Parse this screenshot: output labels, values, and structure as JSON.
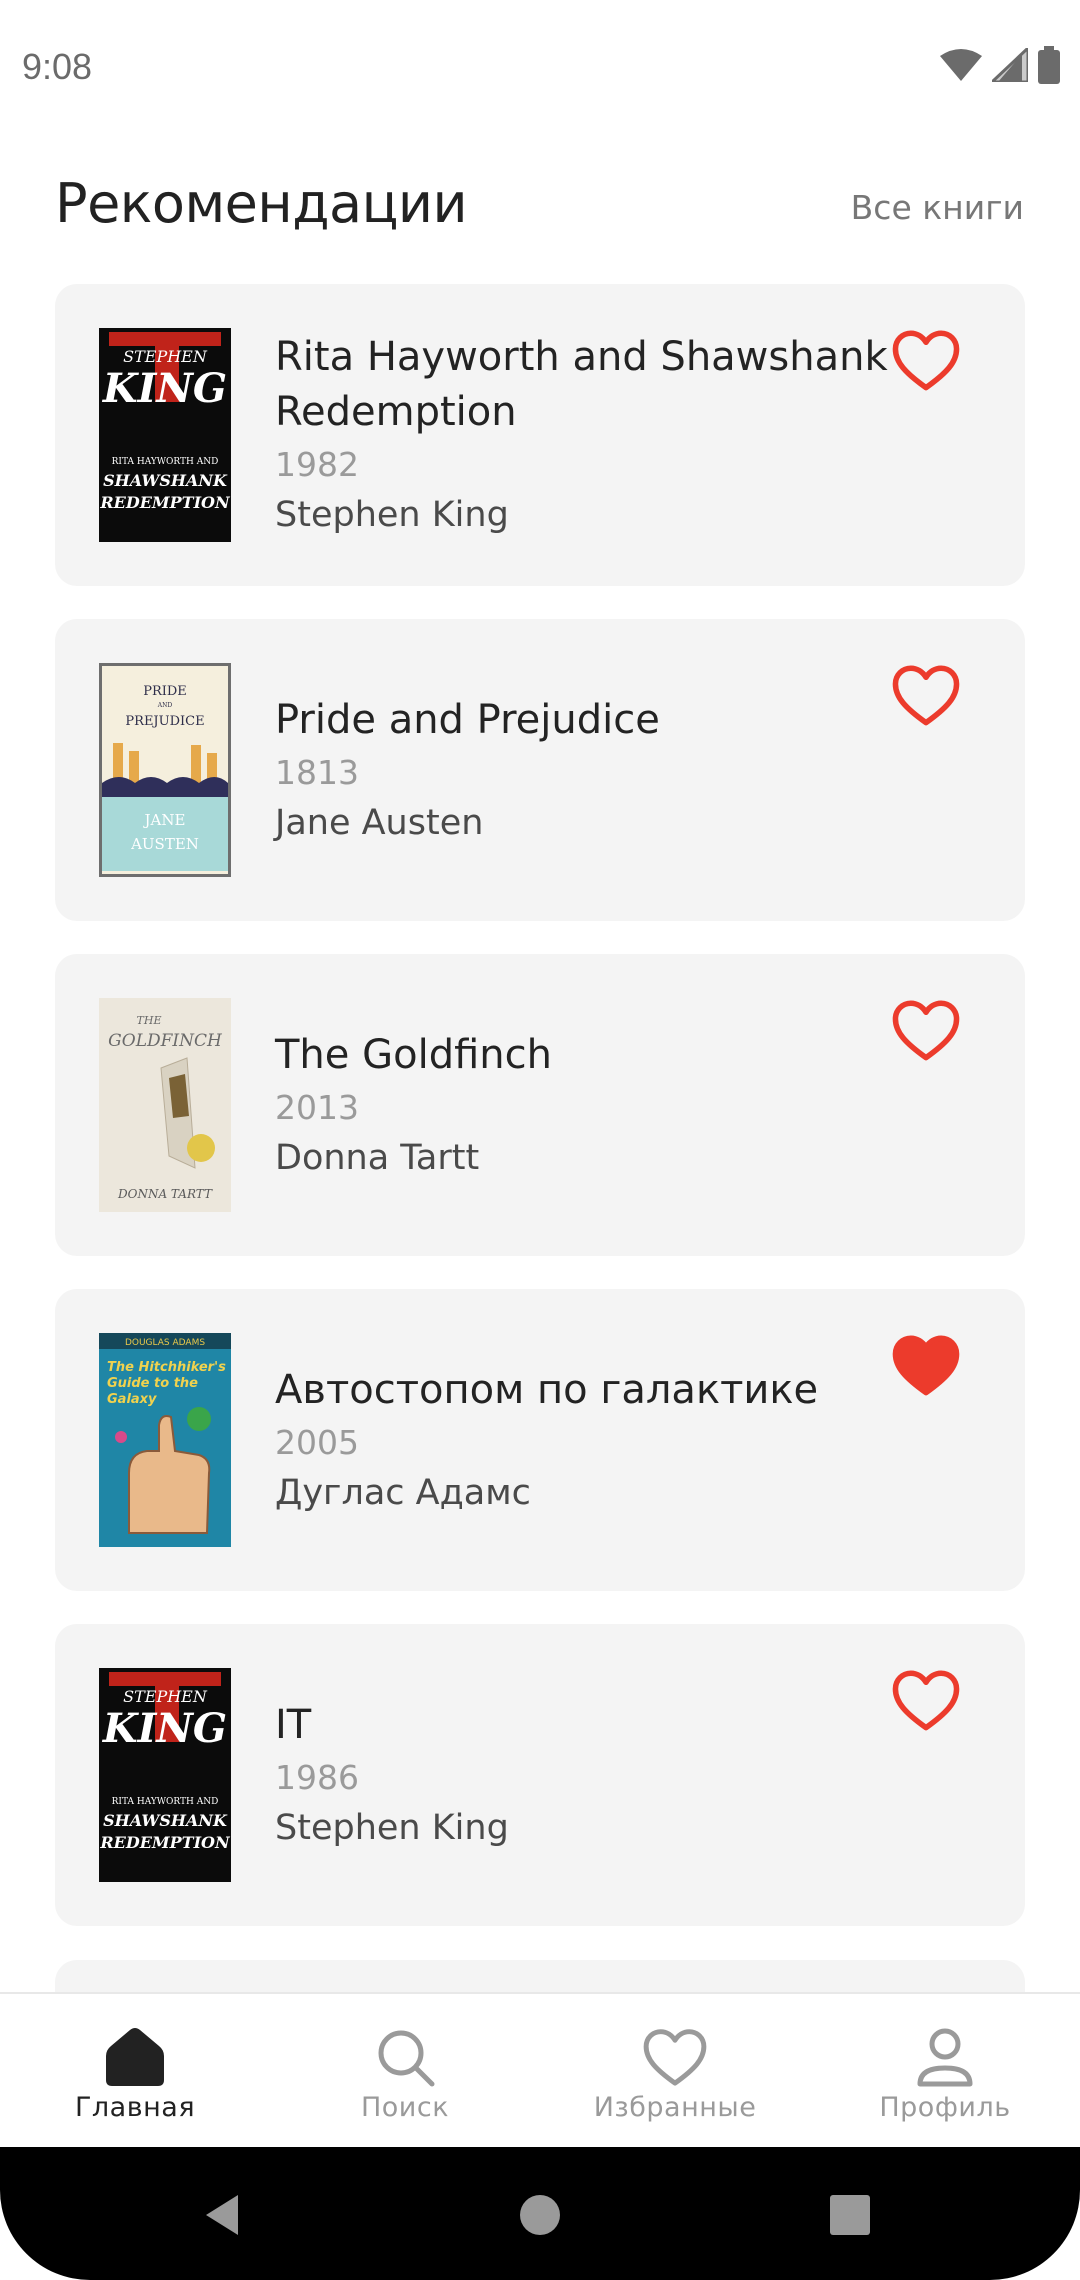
{
  "status_bar": {
    "time": "9:08"
  },
  "header": {
    "title": "Рекомендации",
    "see_all_label": "Все книги"
  },
  "books": [
    {
      "title": "Rita Hayworth and Shawshank Redemption",
      "year": "1982",
      "author": "Stephen King",
      "favorite": false,
      "cover": "stephen-king-cover"
    },
    {
      "title": "Pride and Prejudice",
      "year": "1813",
      "author": "Jane Austen",
      "favorite": false,
      "cover": "pride-prejudice-cover"
    },
    {
      "title": "The Goldfinch",
      "year": "2013",
      "author": "Donna Tartt",
      "favorite": false,
      "cover": "goldfinch-cover"
    },
    {
      "title": "Автостопом по галактике",
      "year": "2005",
      "author": "Дуглас Адамс",
      "favorite": true,
      "cover": "hitchhiker-cover"
    },
    {
      "title": "IT",
      "year": "1986",
      "author": "Stephen King",
      "favorite": false,
      "cover": "stephen-king-cover"
    }
  ],
  "nav": {
    "items": [
      {
        "label": "Главная",
        "icon": "home-icon",
        "active": true
      },
      {
        "label": "Поиск",
        "icon": "search-icon",
        "active": false
      },
      {
        "label": "Избранные",
        "icon": "heart-icon",
        "active": false
      },
      {
        "label": "Профиль",
        "icon": "profile-icon",
        "active": false
      }
    ]
  },
  "colors": {
    "accent_red": "#ec3b2c",
    "card_bg": "#f4f4f4",
    "text_dark": "#222222",
    "text_muted": "#9a9a9a"
  }
}
